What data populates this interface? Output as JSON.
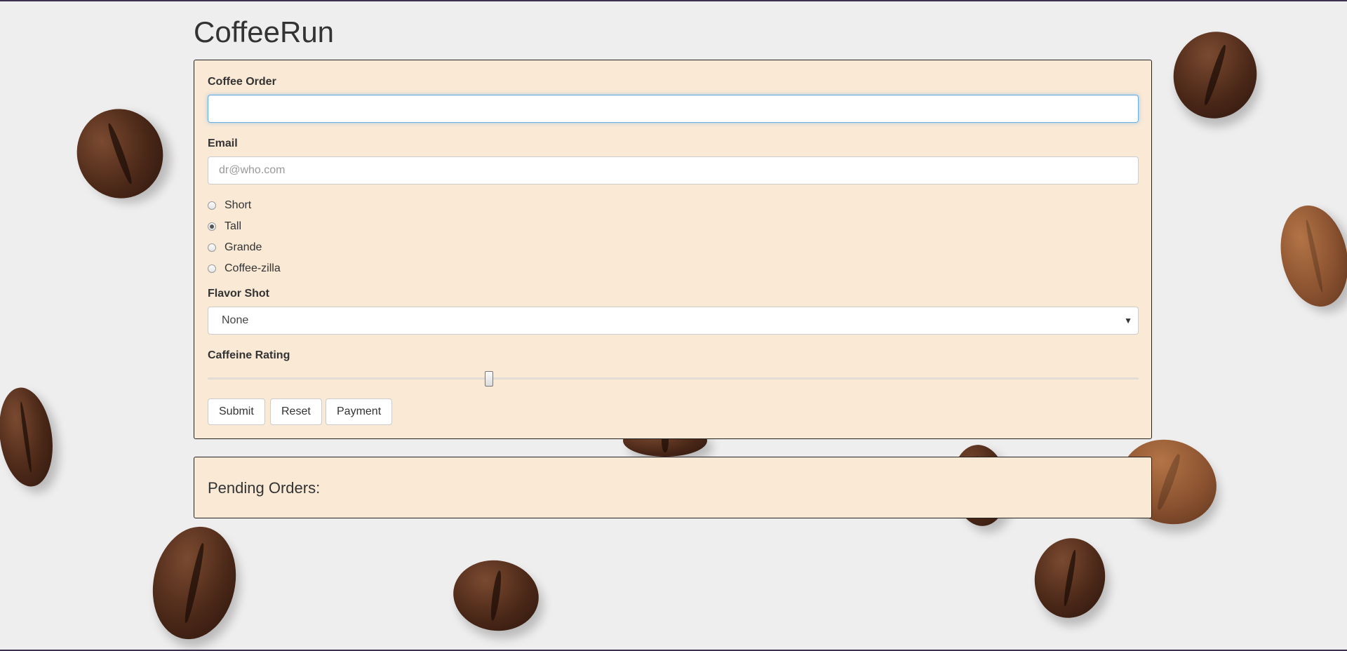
{
  "app": {
    "title": "CoffeeRun"
  },
  "form": {
    "coffee_order_label": "Coffee Order",
    "coffee_order_value": "",
    "email_label": "Email",
    "email_placeholder": "dr@who.com",
    "sizes": [
      {
        "label": "Short",
        "checked": false
      },
      {
        "label": "Tall",
        "checked": true
      },
      {
        "label": "Grande",
        "checked": false
      },
      {
        "label": "Coffee-zilla",
        "checked": false
      }
    ],
    "flavor_label": "Flavor Shot",
    "flavor_selected": "None",
    "caffeine_label": "Caffeine Rating",
    "caffeine_value_fraction": 0.3,
    "buttons": {
      "submit": "Submit",
      "reset": "Reset",
      "payment": "Payment"
    }
  },
  "pending": {
    "title": "Pending Orders:"
  },
  "icons": {
    "select_caret": "chevron-down-icon"
  },
  "colors": {
    "panel_bg": "#f9e9d5",
    "focus_border": "#66afe9"
  }
}
